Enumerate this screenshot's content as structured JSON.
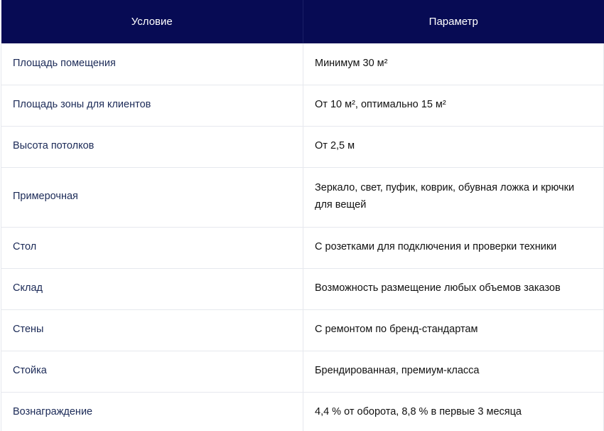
{
  "table": {
    "headers": {
      "condition": "Условие",
      "parameter": "Параметр"
    },
    "rows": [
      {
        "condition": "Площадь помещения",
        "parameter": "Минимум 30 м²"
      },
      {
        "condition": "Площадь зоны для клиентов",
        "parameter": "От 10 м², оптимально 15 м²"
      },
      {
        "condition": "Высота потолков",
        "parameter": "От 2,5 м"
      },
      {
        "condition": "Примерочная",
        "parameter": "Зеркало, свет, пуфик, коврик, обувная ложка и крючки для вещей"
      },
      {
        "condition": "Стол",
        "parameter": "С розетками для подключения и проверки техники"
      },
      {
        "condition": "Склад",
        "parameter": "Возможность размещение любых объемов заказов"
      },
      {
        "condition": "Стены",
        "parameter": "С ремонтом по бренд-стандартам"
      },
      {
        "condition": "Стойка",
        "parameter": "Брендированная, премиум-класса"
      },
      {
        "condition": "Вознаграждение",
        "parameter": "4,4 % от оборота, 8,8 % в первые 3 месяца"
      }
    ]
  }
}
